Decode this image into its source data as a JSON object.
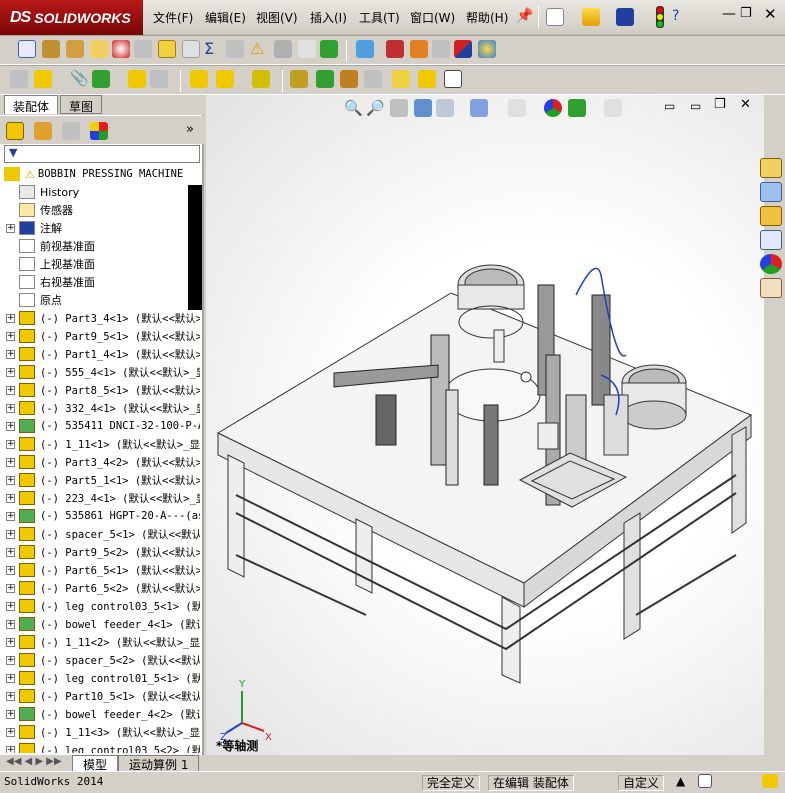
{
  "app": {
    "logo": "SOLIDWORKS",
    "logo_prefix": "DS"
  },
  "menu": [
    "文件(F)",
    "编辑(E)",
    "视图(V)",
    "插入(I)",
    "工具(T)",
    "窗口(W)",
    "帮助(H)"
  ],
  "panel_tabs": [
    "装配体",
    "草图"
  ],
  "tree": {
    "root": "BOBBIN PRESSING MACHINE",
    "folders": [
      "History",
      "传感器",
      "注解",
      "前视基准面",
      "上视基准面",
      "右视基准面",
      "原点"
    ],
    "parts": [
      "(-) Part3_4<1> (默认<<默认>_",
      "(-) Part9_5<1> (默认<<默认>_",
      "(-) Part1_4<1> (默认<<默认>_",
      "(-) 555_4<1> (默认<<默认>_显",
      "(-) Part8_5<1> (默认<<默认>_",
      "(-) 332_4<1> (默认<<默认>_显",
      "(-) 535411 DNCI-32-100-P-A<",
      "(-) 1_11<1> (默认<<默认>_显示",
      "(-) Part3_4<2> (默认<<默认>_",
      "(-) Part5_1<1> (默认<<默认>_",
      "(-) 223_4<1> (默认<<默认>_显",
      "(-) 535861 HGPT-20-A---(asm",
      "(-) spacer_5<1> (默认<<默认>",
      "(-) Part9_5<2> (默认<<默认>_",
      "(-) Part6_5<1> (默认<<默认>_",
      "(-) Part6_5<2> (默认<<默认>_",
      "(-) leg control03_5<1> (默认",
      "(-) bowel feeder_4<1> (默认<",
      "(-) 1_11<2> (默认<<默认>_显示",
      "(-) spacer_5<2> (默认<<默认>",
      "(-) leg control01_5<1> (默认",
      "(-) Part10_5<1> (默认<<默认>",
      "(-) bowel feeder_4<2> (默认<",
      "(-) 1_11<3> (默认<<默认>_显示",
      "(-) leg control03_5<2> (默认"
    ]
  },
  "viewport": {
    "view_label": "*等轴测",
    "axes": {
      "x": "X",
      "y": "Y",
      "z": "Z"
    }
  },
  "bottom_tabs": [
    "模型",
    "运动算例 1"
  ],
  "status": {
    "app_version": "SolidWorks 2014",
    "definition": "完全定义",
    "mode": "在编辑 装配体",
    "units": "自定义"
  },
  "colors": {
    "logo_red": "#a01010",
    "toolbar_bg": "#d4d0c8",
    "part_yellow": "#f0c800"
  }
}
